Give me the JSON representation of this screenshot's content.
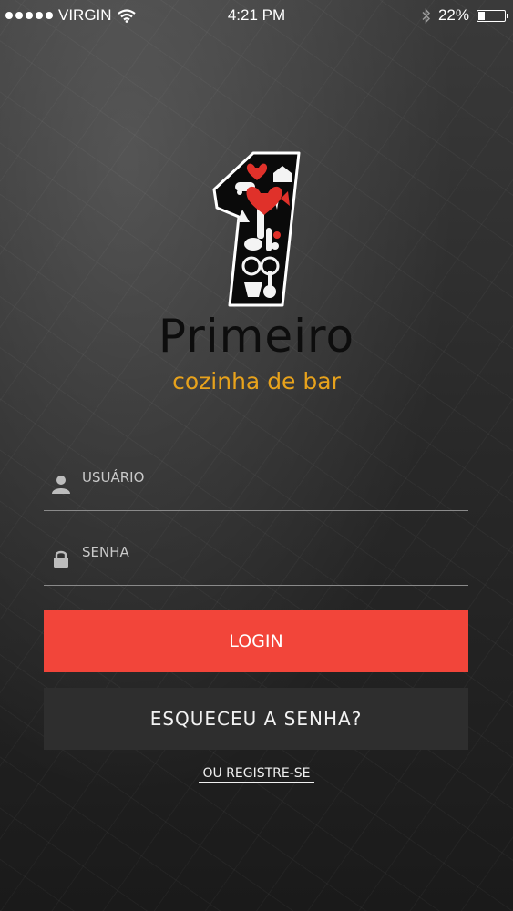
{
  "status_bar": {
    "carrier": "VIRGIN",
    "time": "4:21 PM",
    "battery": "22%",
    "battery_level": 0.22
  },
  "brand": {
    "name": "Primeiro",
    "tagline": "cozinha de bar",
    "tagline_color": "#e7a21c",
    "logo_accent": "#e0312a"
  },
  "login_form": {
    "username_placeholder": "USUÁRIO",
    "password_placeholder": "SENHA",
    "login_label": "LOGIN",
    "forgot_label": "ESQUECEU A SENHA?",
    "register_label": "OU REGISTRE-SE"
  },
  "colors": {
    "login_button": "#f2453a",
    "secondary_button": "#2e2e2e"
  }
}
